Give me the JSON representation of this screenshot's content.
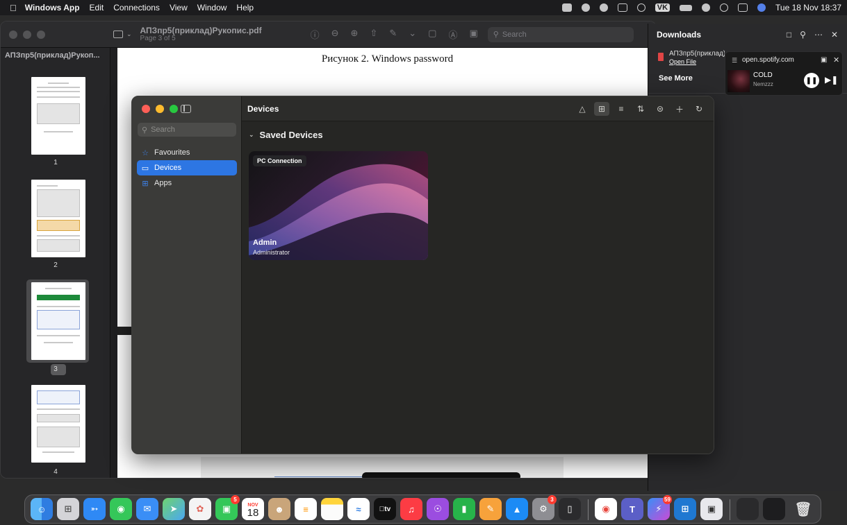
{
  "menubar": {
    "app_name": "Windows App",
    "menus": [
      "Edit",
      "Connections",
      "View",
      "Window",
      "Help"
    ],
    "vk_label": "VK",
    "datetime": "Tue 18 Nov 18:37"
  },
  "pdf": {
    "title": "АПЗпр5(приклад)Рукопис.pdf",
    "subtitle": "Page 3 of 5",
    "search_placeholder": "Search",
    "thumbs_title": "АПЗпр5(приклад)Рукоп...",
    "thumb_numbers": [
      "1",
      "2",
      "3",
      "4"
    ],
    "heading": "Рисунок 2. Windows password"
  },
  "downloads": {
    "title": "Downloads",
    "file_name": "АПЗпр5(приклад)Р",
    "open_file": "Open File",
    "see_more": "See More"
  },
  "spotify": {
    "site": "open.spotify.com",
    "song": "COLD",
    "artist": "Nemzzz"
  },
  "winapp": {
    "search_placeholder": "Search",
    "nav": [
      {
        "label": "Favourites",
        "icon": "star-icon"
      },
      {
        "label": "Devices",
        "icon": "monitor-icon"
      },
      {
        "label": "Apps",
        "icon": "grid-icon"
      }
    ],
    "title": "Devices",
    "section": "Saved Devices",
    "card": {
      "tag": "PC Connection",
      "name": "Admin",
      "role": "Administrator"
    }
  },
  "dock": {
    "calendar_month": "NOV",
    "calendar_day": "18",
    "badges": {
      "facetime": "5",
      "settings": "3",
      "messenger": "59"
    }
  }
}
